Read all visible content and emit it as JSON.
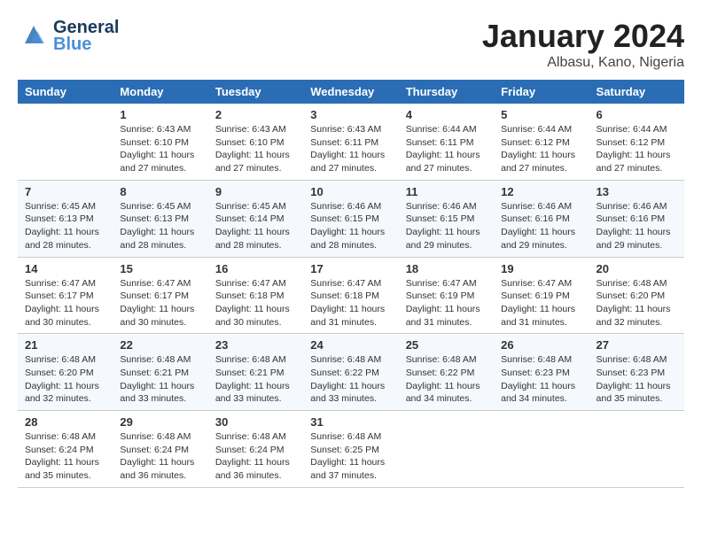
{
  "header": {
    "logo_line1": "General",
    "logo_line2": "Blue",
    "month_title": "January 2024",
    "location": "Albasu, Kano, Nigeria"
  },
  "columns": [
    "Sunday",
    "Monday",
    "Tuesday",
    "Wednesday",
    "Thursday",
    "Friday",
    "Saturday"
  ],
  "weeks": [
    [
      {
        "day": "",
        "sunrise": "",
        "sunset": "",
        "daylight": ""
      },
      {
        "day": "1",
        "sunrise": "Sunrise: 6:43 AM",
        "sunset": "Sunset: 6:10 PM",
        "daylight": "Daylight: 11 hours and 27 minutes."
      },
      {
        "day": "2",
        "sunrise": "Sunrise: 6:43 AM",
        "sunset": "Sunset: 6:10 PM",
        "daylight": "Daylight: 11 hours and 27 minutes."
      },
      {
        "day": "3",
        "sunrise": "Sunrise: 6:43 AM",
        "sunset": "Sunset: 6:11 PM",
        "daylight": "Daylight: 11 hours and 27 minutes."
      },
      {
        "day": "4",
        "sunrise": "Sunrise: 6:44 AM",
        "sunset": "Sunset: 6:11 PM",
        "daylight": "Daylight: 11 hours and 27 minutes."
      },
      {
        "day": "5",
        "sunrise": "Sunrise: 6:44 AM",
        "sunset": "Sunset: 6:12 PM",
        "daylight": "Daylight: 11 hours and 27 minutes."
      },
      {
        "day": "6",
        "sunrise": "Sunrise: 6:44 AM",
        "sunset": "Sunset: 6:12 PM",
        "daylight": "Daylight: 11 hours and 27 minutes."
      }
    ],
    [
      {
        "day": "7",
        "sunrise": "Sunrise: 6:45 AM",
        "sunset": "Sunset: 6:13 PM",
        "daylight": "Daylight: 11 hours and 28 minutes."
      },
      {
        "day": "8",
        "sunrise": "Sunrise: 6:45 AM",
        "sunset": "Sunset: 6:13 PM",
        "daylight": "Daylight: 11 hours and 28 minutes."
      },
      {
        "day": "9",
        "sunrise": "Sunrise: 6:45 AM",
        "sunset": "Sunset: 6:14 PM",
        "daylight": "Daylight: 11 hours and 28 minutes."
      },
      {
        "day": "10",
        "sunrise": "Sunrise: 6:46 AM",
        "sunset": "Sunset: 6:15 PM",
        "daylight": "Daylight: 11 hours and 28 minutes."
      },
      {
        "day": "11",
        "sunrise": "Sunrise: 6:46 AM",
        "sunset": "Sunset: 6:15 PM",
        "daylight": "Daylight: 11 hours and 29 minutes."
      },
      {
        "day": "12",
        "sunrise": "Sunrise: 6:46 AM",
        "sunset": "Sunset: 6:16 PM",
        "daylight": "Daylight: 11 hours and 29 minutes."
      },
      {
        "day": "13",
        "sunrise": "Sunrise: 6:46 AM",
        "sunset": "Sunset: 6:16 PM",
        "daylight": "Daylight: 11 hours and 29 minutes."
      }
    ],
    [
      {
        "day": "14",
        "sunrise": "Sunrise: 6:47 AM",
        "sunset": "Sunset: 6:17 PM",
        "daylight": "Daylight: 11 hours and 30 minutes."
      },
      {
        "day": "15",
        "sunrise": "Sunrise: 6:47 AM",
        "sunset": "Sunset: 6:17 PM",
        "daylight": "Daylight: 11 hours and 30 minutes."
      },
      {
        "day": "16",
        "sunrise": "Sunrise: 6:47 AM",
        "sunset": "Sunset: 6:18 PM",
        "daylight": "Daylight: 11 hours and 30 minutes."
      },
      {
        "day": "17",
        "sunrise": "Sunrise: 6:47 AM",
        "sunset": "Sunset: 6:18 PM",
        "daylight": "Daylight: 11 hours and 31 minutes."
      },
      {
        "day": "18",
        "sunrise": "Sunrise: 6:47 AM",
        "sunset": "Sunset: 6:19 PM",
        "daylight": "Daylight: 11 hours and 31 minutes."
      },
      {
        "day": "19",
        "sunrise": "Sunrise: 6:47 AM",
        "sunset": "Sunset: 6:19 PM",
        "daylight": "Daylight: 11 hours and 31 minutes."
      },
      {
        "day": "20",
        "sunrise": "Sunrise: 6:48 AM",
        "sunset": "Sunset: 6:20 PM",
        "daylight": "Daylight: 11 hours and 32 minutes."
      }
    ],
    [
      {
        "day": "21",
        "sunrise": "Sunrise: 6:48 AM",
        "sunset": "Sunset: 6:20 PM",
        "daylight": "Daylight: 11 hours and 32 minutes."
      },
      {
        "day": "22",
        "sunrise": "Sunrise: 6:48 AM",
        "sunset": "Sunset: 6:21 PM",
        "daylight": "Daylight: 11 hours and 33 minutes."
      },
      {
        "day": "23",
        "sunrise": "Sunrise: 6:48 AM",
        "sunset": "Sunset: 6:21 PM",
        "daylight": "Daylight: 11 hours and 33 minutes."
      },
      {
        "day": "24",
        "sunrise": "Sunrise: 6:48 AM",
        "sunset": "Sunset: 6:22 PM",
        "daylight": "Daylight: 11 hours and 33 minutes."
      },
      {
        "day": "25",
        "sunrise": "Sunrise: 6:48 AM",
        "sunset": "Sunset: 6:22 PM",
        "daylight": "Daylight: 11 hours and 34 minutes."
      },
      {
        "day": "26",
        "sunrise": "Sunrise: 6:48 AM",
        "sunset": "Sunset: 6:23 PM",
        "daylight": "Daylight: 11 hours and 34 minutes."
      },
      {
        "day": "27",
        "sunrise": "Sunrise: 6:48 AM",
        "sunset": "Sunset: 6:23 PM",
        "daylight": "Daylight: 11 hours and 35 minutes."
      }
    ],
    [
      {
        "day": "28",
        "sunrise": "Sunrise: 6:48 AM",
        "sunset": "Sunset: 6:24 PM",
        "daylight": "Daylight: 11 hours and 35 minutes."
      },
      {
        "day": "29",
        "sunrise": "Sunrise: 6:48 AM",
        "sunset": "Sunset: 6:24 PM",
        "daylight": "Daylight: 11 hours and 36 minutes."
      },
      {
        "day": "30",
        "sunrise": "Sunrise: 6:48 AM",
        "sunset": "Sunset: 6:24 PM",
        "daylight": "Daylight: 11 hours and 36 minutes."
      },
      {
        "day": "31",
        "sunrise": "Sunrise: 6:48 AM",
        "sunset": "Sunset: 6:25 PM",
        "daylight": "Daylight: 11 hours and 37 minutes."
      },
      {
        "day": "",
        "sunrise": "",
        "sunset": "",
        "daylight": ""
      },
      {
        "day": "",
        "sunrise": "",
        "sunset": "",
        "daylight": ""
      },
      {
        "day": "",
        "sunrise": "",
        "sunset": "",
        "daylight": ""
      }
    ]
  ]
}
